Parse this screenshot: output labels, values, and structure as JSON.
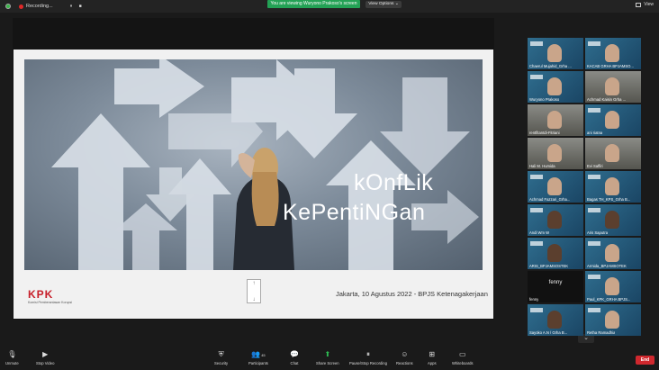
{
  "topbar": {
    "recording_label": "Recording...",
    "pause_icon": "⏸",
    "stop_icon": "■",
    "banner": "You are viewing Wuryono Prakoso's screen",
    "view_options": "View Options ⌄",
    "view_label": "View"
  },
  "slide": {
    "title_line1": "kOnfLik",
    "title_line2": "KePentiNGan",
    "logo": "KPK",
    "logo_sub": "Komisi Pemberantasan Korupsi",
    "footer": "Jakarta, 10 Agustus 2022 - BPJS Ketenagakerjaan",
    "scroll_hint": "↑\n↓"
  },
  "participants": [
    {
      "name": "Chaerul Mujahid_Grha ..."
    },
    {
      "name": "KACAB GRHA BPJAMSO..."
    },
    {
      "name": "Wuryono Prakoso"
    },
    {
      "name": "Achmad Kaisin Grha ..."
    },
    {
      "name": "rentfitantdi-Fitriani"
    },
    {
      "name": "ani riatna"
    },
    {
      "name": "Hali M. Humida"
    },
    {
      "name": "Evi Saffiri"
    },
    {
      "name": "Achmad Fazzari_Grha..."
    },
    {
      "name": "Bagas TH_KPS_Grha B..."
    },
    {
      "name": "Andi Wm W"
    },
    {
      "name": "Aris Saputra"
    },
    {
      "name": "ARIS_BPJAMSOSTEK"
    },
    {
      "name": "Armida_BPJAMSOTEK"
    },
    {
      "name": "fenny"
    },
    {
      "name": "Paul_KPK_GRHA BPJS..."
    },
    {
      "name": "Sayoko A.N / Grha B..."
    },
    {
      "name": "Retha Ramadhia"
    }
  ],
  "toolbar": {
    "unmute": "Unmute",
    "stop_video": "Stop Video",
    "security": "Security",
    "participants": "Participants",
    "participant_count": "45",
    "chat": "Chat",
    "share_screen": "Share Screen",
    "pause_recording": "Pause/Stop Recording",
    "reactions": "Reactions",
    "apps": "Apps",
    "whiteboards": "Whiteboards",
    "end": "End"
  },
  "colors": {
    "banner": "#23a155",
    "end": "#d0282e",
    "active_speaker": "#e4e23b",
    "kpk_red": "#c71f2a"
  }
}
